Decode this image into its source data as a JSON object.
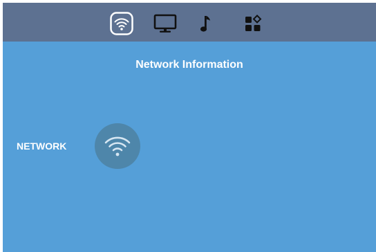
{
  "colors": {
    "background": "#559fd8",
    "topbar": "#5d7191",
    "active_tab_outline": "#ffffff",
    "status_circle": "#4e86aa",
    "text": "#ffffff"
  },
  "tabs": [
    {
      "icon": "wifi-icon",
      "active": true
    },
    {
      "icon": "monitor-icon",
      "active": false
    },
    {
      "icon": "music-note-icon",
      "active": false
    },
    {
      "icon": "apps-grid-icon",
      "active": false
    }
  ],
  "page": {
    "title": "Network Information"
  },
  "network": {
    "label": "NETWORK",
    "icon": "wifi-icon"
  }
}
